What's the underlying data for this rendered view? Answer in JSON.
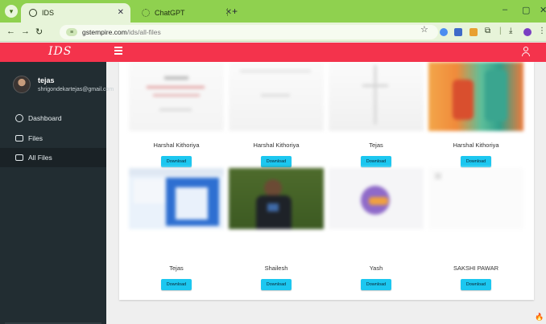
{
  "browser": {
    "tabs": [
      {
        "label": "IDS",
        "active": true
      },
      {
        "label": "ChatGPT",
        "active": false
      }
    ],
    "url_domain": "gstempire.com",
    "url_path": "/ids/all-files",
    "new_tab": "+",
    "window_controls": [
      "–",
      "▢",
      "✕"
    ]
  },
  "app": {
    "brand": "IDS",
    "accent_color": "#f4334c",
    "button_color": "#1cc7f0"
  },
  "user": {
    "name": "tejas",
    "email": "shrigondekartejas@gmail.com"
  },
  "sidebar": {
    "items": [
      {
        "label": "Dashboard",
        "icon": "dashboard-icon"
      },
      {
        "label": "Files",
        "icon": "image-icon"
      },
      {
        "label": "All Files",
        "icon": "image-icon",
        "active": true
      }
    ]
  },
  "files": {
    "download_label": "Download",
    "rows": [
      [
        {
          "name": "Harshal Kithoriya"
        },
        {
          "name": "Harshal Kithoriya"
        },
        {
          "name": "Tejas"
        },
        {
          "name": "Harshal Kithoriya"
        }
      ],
      [
        {
          "name": "Tejas"
        },
        {
          "name": "Shailesh"
        },
        {
          "name": "Yash"
        },
        {
          "name": "SAKSHI PAWAR"
        }
      ]
    ]
  }
}
